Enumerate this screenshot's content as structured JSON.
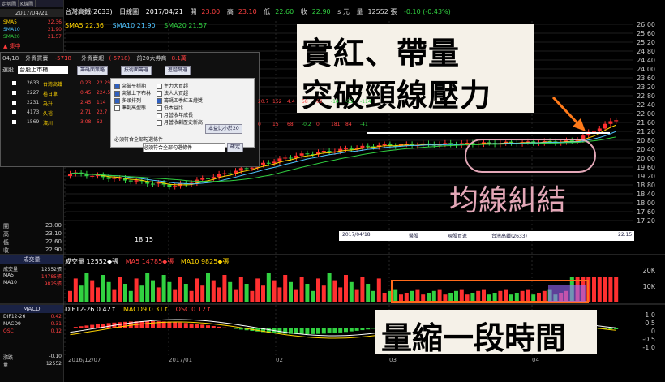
{
  "left_panel": {
    "tabs": [
      "走勢圖",
      "K線圖"
    ],
    "date": "2017/04/21",
    "ma_rows": [
      {
        "label": "SMA5",
        "value": "22.36"
      },
      {
        "label": "SMA10",
        "value": "21.90"
      },
      {
        "label": "SMA20",
        "value": "21.57"
      }
    ],
    "change_text": "▲ 集中",
    "ohlc": [
      {
        "label": "開",
        "value": "23.00"
      },
      {
        "label": "高",
        "value": "23.10"
      },
      {
        "label": "低",
        "value": "22.60"
      },
      {
        "label": "收",
        "value": "22.90"
      }
    ],
    "volume_head": "成交量",
    "volume_rows": [
      {
        "label": "成交量",
        "value": "12552張"
      },
      {
        "label": "MA5",
        "value": "14785張"
      },
      {
        "label": "MA10",
        "value": "9825張"
      }
    ],
    "macd_head": "MACD",
    "macd_rows": [
      {
        "label": "DIF12-26",
        "value": "0.42"
      },
      {
        "label": "MACD9",
        "value": "0.31"
      },
      {
        "label": "OSC",
        "value": "0.12"
      }
    ],
    "bottom_rows": [
      {
        "label": "漲跌",
        "value": "-0.10"
      },
      {
        "label": "量",
        "value": "12552"
      }
    ]
  },
  "header": {
    "name": "台灣高鐵(2633)",
    "period": "日線圖",
    "date": "2017/04/21",
    "open_label": "開",
    "open": "23.00",
    "high_label": "高",
    "high": "23.10",
    "low_label": "低",
    "low": "22.60",
    "close_label": "收",
    "close": "22.90",
    "close_suffix": "s 元",
    "volume_label": "量",
    "volume": "12552 張",
    "change": "-0.10 (-0.43%)"
  },
  "ma_legend": [
    {
      "label": "SMA5 22.36",
      "color": "#ffd400"
    },
    {
      "label": "SMA10 21.90",
      "color": "#4fc3ff"
    },
    {
      "label": "SMA20 21.57",
      "color": "#31d141"
    }
  ],
  "dialog": {
    "row1": [
      "04/18",
      "外資買賣",
      "-5718",
      "外資賣超",
      "(-5718)",
      "前20大券商",
      "8.1萬"
    ],
    "market_label": "選股",
    "market_value": "台股上市櫃",
    "buttons": [
      "籌碼面策略",
      "技術面籌選",
      "進階篩選"
    ],
    "options": [
      {
        "label": "突破平穩期",
        "on": true
      },
      {
        "label": "突破上下布林",
        "on": true
      },
      {
        "label": "多頭排列",
        "on": true
      },
      {
        "label": "準創高型態",
        "on": false
      },
      {
        "label": "主力大買超",
        "on": false
      },
      {
        "label": "法人大買超",
        "on": false
      },
      {
        "label": "籌碼四季紅五燈獎",
        "on": true
      },
      {
        "label": "低本益比",
        "on": false
      },
      {
        "label": "月營收年成長",
        "on": false
      },
      {
        "label": "月營收創歷史新高",
        "on": false
      }
    ],
    "side_button": "本益比小於20",
    "conditions": [
      "必須符合全部勾選條件"
    ],
    "confirm": "確定",
    "stocks": [
      {
        "code": "2633",
        "name": "台灣高鐵",
        "price": "0.23",
        "chg": "22.2%"
      },
      {
        "code": "2227",
        "name": "裕日車",
        "price": "0.45",
        "chg": "224.5"
      },
      {
        "code": "2231",
        "name": "為升",
        "price": "2.45",
        "chg": "114"
      },
      {
        "code": "4173",
        "name": "久裕",
        "price": "2.71",
        "chg": "22.7"
      },
      {
        "code": "1569",
        "name": "濱川",
        "price": "3.08",
        "chg": "52"
      }
    ],
    "grid_numbers": [
      "20.7",
      "152",
      "4.4",
      "58",
      "62",
      "-14",
      "-52",
      "-114",
      "0",
      "15",
      "68",
      "-0.2",
      "0",
      "181",
      "84",
      "-41"
    ]
  },
  "price_axis": [
    "26.00",
    "25.60",
    "25.20",
    "24.80",
    "24.40",
    "24.00",
    "23.60",
    "23.20",
    "22.80",
    "22.40",
    "22.00",
    "21.60",
    "21.20",
    "20.80",
    "20.40",
    "20.00",
    "19.60",
    "19.20",
    "18.80",
    "18.40",
    "18.00",
    "17.60",
    "17.20"
  ],
  "low_marker": "18.15",
  "info_strip": [
    "2017/04/18",
    "醫股",
    "現股買進",
    "台灣高鐵(2633)",
    "22.15"
  ],
  "volume_header": {
    "vol": "成交量 12552◆張",
    "ma5": "MA5 14785◆張",
    "ma10": "MA10 9825◆張"
  },
  "volume_axis": [
    "20K",
    "10K"
  ],
  "macd_header": {
    "dif": "DIF12-26 0.42↑",
    "macd": "MACD9 0.31↑",
    "osc": "OSC 0.12↑"
  },
  "macd_axis": [
    "1.0",
    "0.5",
    "0",
    "-0.5",
    "-1.0"
  ],
  "date_axis": [
    "2016/12/07",
    "2017/01",
    "02",
    "03",
    "04"
  ],
  "annotations": {
    "breakout_line1": "實紅、帶量",
    "breakout_line2": "突破頸線壓力",
    "ma_tangle": "均線糾結",
    "volume_shrink": "量縮一段時間"
  },
  "colors": {
    "up": "#ff3030",
    "down": "#31d141",
    "ma5": "#ffd400",
    "ma10": "#4fc3ff",
    "ma20": "#31d141",
    "callout_bg": "#f5f1e8",
    "highlight_box": "#ff6a1a"
  }
}
